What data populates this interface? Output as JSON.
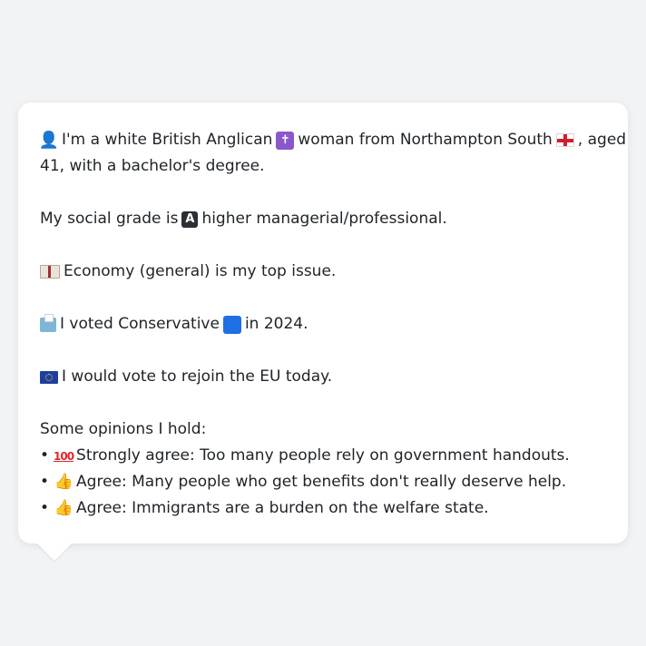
{
  "profile": {
    "line1_a": "I'm a white British Anglican",
    "line1_b": "woman from Northampton South",
    "line1_c": ", aged",
    "line2": "41, with a bachelor's degree.",
    "grade_a": "My social grade is",
    "grade_b": "higher managerial/professional.",
    "issue": "Economy (general) is my top issue.",
    "vote_a": "I voted Conservative",
    "vote_b": "in 2024.",
    "eu": "I would vote to rejoin the EU today.",
    "opinions_heading": "Some opinions I hold:",
    "opinions": [
      {
        "bullet": "•",
        "icon": "hundred-icon",
        "icon_text": "100",
        "text": "Strongly agree: Too many people rely on government handouts."
      },
      {
        "bullet": "•",
        "icon": "thumbs-up-icon",
        "icon_text": "👍",
        "text": "Agree: Many people who get benefits don't really deserve help."
      },
      {
        "bullet": "•",
        "icon": "thumbs-up-icon",
        "icon_text": "👍",
        "text": "Agree: Immigrants are a burden on the welfare state."
      }
    ]
  },
  "icons": {
    "person": "person-silhouette-icon",
    "religion": "latin-cross-icon",
    "religion_glyph": "✝",
    "region": "england-flag-icon",
    "grade": "letter-a-icon",
    "grade_glyph": "A",
    "issue": "banknote-icon",
    "vote": "ballot-box-icon",
    "party": "blue-square-icon",
    "eu": "eu-flag-icon"
  },
  "colors": {
    "background": "#f2f3f5",
    "bubble": "#ffffff",
    "text": "#1f2328",
    "party_blue": "#1f6fe5"
  }
}
